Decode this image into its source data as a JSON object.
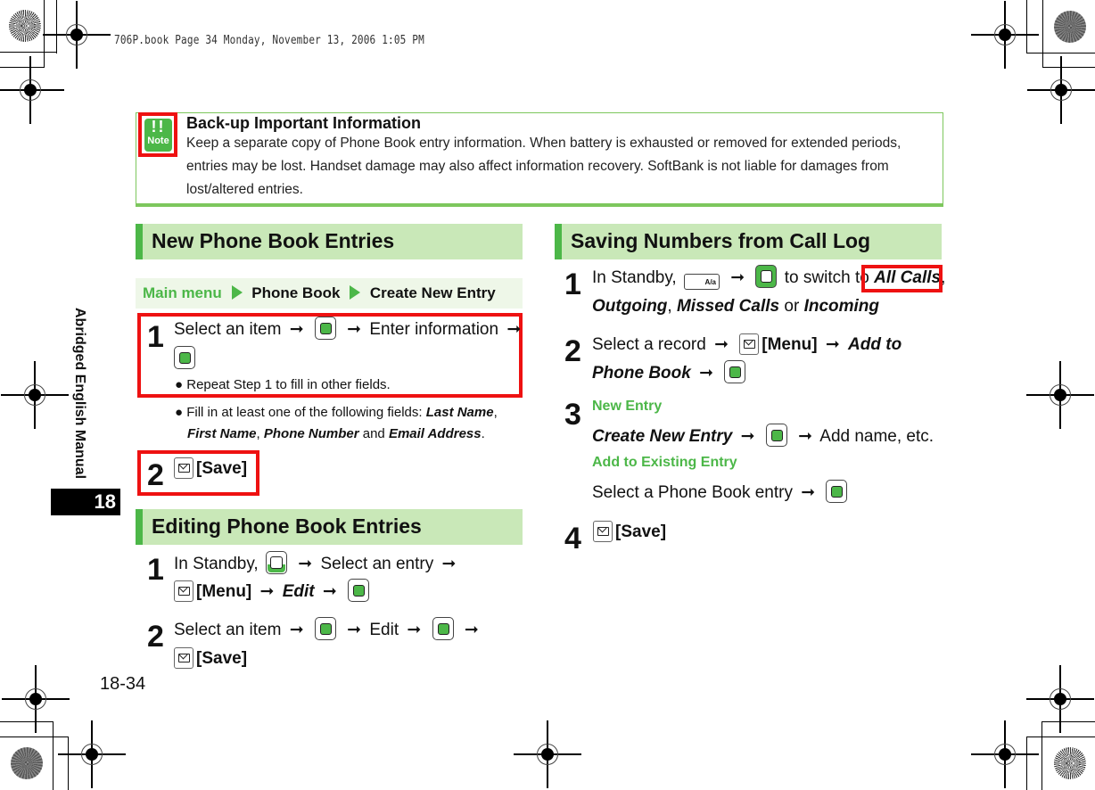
{
  "print_header": "706P.book  Page 34  Monday, November 13, 2006  1:05 PM",
  "note": {
    "icon_label": "Note",
    "icon_marks": "!!",
    "title": "Back-up Important Information",
    "text": "Keep a separate copy of Phone Book entry information. When battery is exhausted or removed for extended periods, entries may be lost. Handset damage may also affect information recovery. SoftBank is not liable for damages from lost/altered entries."
  },
  "colors": {
    "accent_green": "#4cb748",
    "section_bg": "#c9e8b8",
    "highlight_red": "#ee1111"
  },
  "sections": {
    "new_entries": {
      "title": "New Phone Book Entries",
      "breadcrumb": [
        "Main menu",
        "Phone Book",
        "Create New Entry"
      ],
      "step1": {
        "num": "1",
        "text_a": "Select an item",
        "text_b": "Enter information",
        "note_a": "Repeat Step 1 to fill in other fields.",
        "note_b_prefix": "Fill in at least one of the following fields:",
        "fields": [
          "Last Name",
          "First Name",
          "Phone Number",
          "Email Address"
        ],
        "and": "and"
      },
      "step2": {
        "num": "2",
        "label": "[Save]"
      }
    },
    "editing": {
      "title": "Editing Phone Book Entries",
      "step1": {
        "num": "1",
        "text_a": "In Standby,",
        "text_b": "Select an entry",
        "menu": "[Menu]",
        "edit": "Edit"
      },
      "step2": {
        "num": "2",
        "text_a": "Select an item",
        "text_b": "Edit",
        "save": "[Save]"
      }
    },
    "call_log": {
      "title": "Saving Numbers from Call Log",
      "step1": {
        "num": "1",
        "text_a": "In Standby,",
        "text_b": "to switch to",
        "opt1": "All Calls",
        "opt2": "Outgoing",
        "opt3": "Missed Calls",
        "or": "or",
        "opt4": "Incoming",
        "call_key_label": "A/a"
      },
      "step2": {
        "num": "2",
        "text_a": "Select a record",
        "menu": "[Menu]",
        "add_to": "Add to",
        "phone_book": "Phone Book"
      },
      "step3": {
        "num": "3",
        "new_label": "New Entry",
        "create": "Create New Entry",
        "add_name": "Add name, etc.",
        "existing_label": "Add to Existing Entry",
        "select_entry": "Select a Phone Book entry"
      },
      "step4": {
        "num": "4",
        "save": "[Save]"
      }
    }
  },
  "arrow": "➞",
  "sidebar": {
    "chapter_title": "Abridged English Manual",
    "chapter_num": "18"
  },
  "page_number": "18-34"
}
